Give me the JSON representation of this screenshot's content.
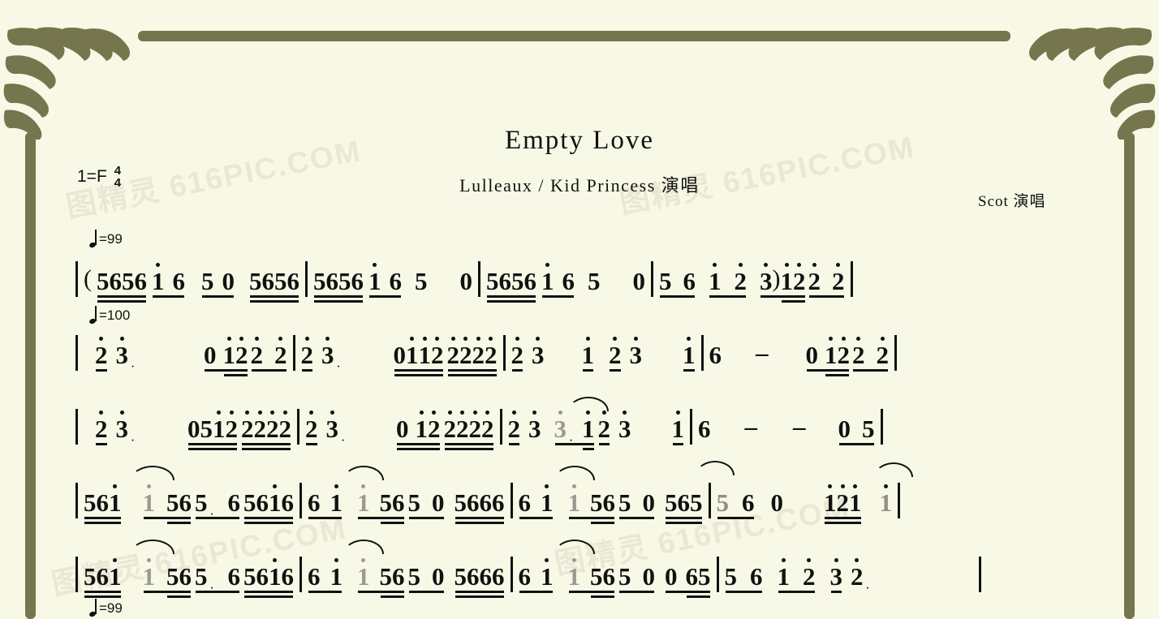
{
  "document": {
    "type": "numbered-musical-notation",
    "title": "Empty Love",
    "subtitle": "Lulleaux / Kid Princess 演唱",
    "credit": "Scot 演唱",
    "key_label": "1=F",
    "time_signature_top": "4",
    "time_signature_bottom": "4",
    "background_color": "#f8f8e6",
    "ornament_color": "#76764e",
    "watermark_text": "图精灵 616PIC.COM"
  },
  "tempo_marks": [
    {
      "id": "tempo-1",
      "value": "=99"
    },
    {
      "id": "tempo-2",
      "value": "=100"
    },
    {
      "id": "tempo-3",
      "value": "=99"
    }
  ],
  "score": {
    "lines": [
      {
        "id": "line-1",
        "measures": [
          {
            "id": "m1",
            "tokens": "( 5656 1̇ 6  5 0  5656"
          },
          {
            "id": "m2",
            "tokens": "5656 1̇ 6  5   0"
          },
          {
            "id": "m3",
            "tokens": "5656 1̇ 6  5   0"
          },
          {
            "id": "m4",
            "tokens": "5 6  1̇ 2̇  3̇) 1̇2̇ 2̇ 2̇"
          }
        ]
      },
      {
        "id": "line-2",
        "measures": [
          {
            "id": "m5",
            "tokens": "2̇ 3̇·   0 1̇2̇ 2̇ 2̇"
          },
          {
            "id": "m6",
            "tokens": "2̇ 3̇·   01̇1̇2̇ 2̇2̇2̇2̇"
          },
          {
            "id": "m7",
            "tokens": "2̇ 3̇   1̇ 2̇ 3̇   1̇"
          },
          {
            "id": "m8",
            "tokens": "6  –   0 1̇2̇ 2̇ 2̇"
          }
        ]
      },
      {
        "id": "line-3",
        "measures": [
          {
            "id": "m9",
            "tokens": "2̇ 3̇·   051̇2̇ 2̇2̇2̇2̇"
          },
          {
            "id": "m10",
            "tokens": "2̇ 3̇·   0 1̇2̇ 2̇2̇2̇2̇"
          },
          {
            "id": "m11",
            "tokens": "2̇ 3̇ 3̇· 1̇ 2̇ 3̇   1̇"
          },
          {
            "id": "m12",
            "tokens": "6  –  –   0 5"
          }
        ]
      },
      {
        "id": "line-4",
        "measures": [
          {
            "id": "m13",
            "tokens": "561̇  1̇ 56 5· 6 561̇6"
          },
          {
            "id": "m14",
            "tokens": "6 1̇  1̇ 56 5 0  5666"
          },
          {
            "id": "m15",
            "tokens": "6 1̇  1̇ 56 5 0  565"
          },
          {
            "id": "m16",
            "tokens": "5 6 0   1̇2̇1̇  1̇"
          }
        ]
      },
      {
        "id": "line-5",
        "measures": [
          {
            "id": "m17",
            "tokens": "561̇  1̇ 56 5· 6 561̇6"
          },
          {
            "id": "m18",
            "tokens": "6 1̇  1̇ 56 5 0  5666"
          },
          {
            "id": "m19",
            "tokens": "6 1̇  1̇ 56 5 0  0 65"
          },
          {
            "id": "m20",
            "tokens": "5 6  1̇ 2̇  3̇ 2̇·"
          }
        ]
      }
    ]
  }
}
